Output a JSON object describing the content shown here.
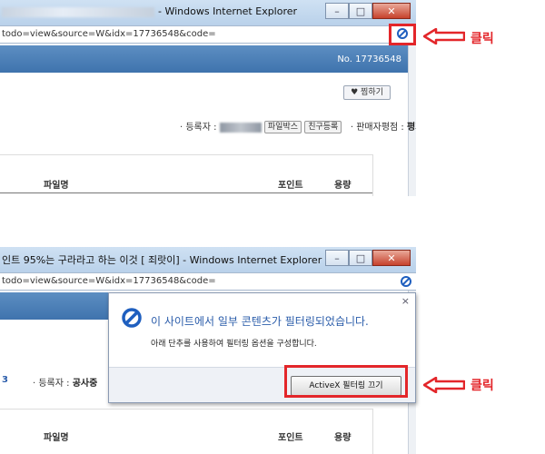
{
  "top_window": {
    "title_suffix": "- Windows Internet Explorer",
    "url": "todo=view&source=W&idx=17736548&code=",
    "record_no": "No. 17736548",
    "save_button": "찜하기",
    "info": {
      "registrant_label": "· 등록자 :",
      "file_box_button": "파일박스",
      "add_friend_button": "친구등록",
      "rating_label": "· 판매자평점 :",
      "rating_value": "평가없음"
    },
    "table_headers": {
      "file_name": "파일명",
      "points": "포인트",
      "capacity": "용량"
    }
  },
  "bottom_window": {
    "title": "인트 95%는 구라라고 하는 이것 [ 죄랏이] - Windows Internet Explorer",
    "url": "todo=view&source=W&idx=17736548&code=",
    "left_fragment": "3",
    "registrant_label": "· 등록자 :",
    "registrant_name": "공사중",
    "table_headers": {
      "file_name": "파일명",
      "points": "포인트",
      "capacity": "용량"
    }
  },
  "infobar": {
    "title": "이 사이트에서 일부 콘텐츠가 필터링되었습니다.",
    "description": "아래 단추를 사용하여 필터링 옵션을 구성합니다.",
    "button": "ActiveX 필터링 끄기",
    "close": "×"
  },
  "annotations": {
    "click_top": "클릭",
    "click_bottom": "클릭",
    "accent_color": "#e3262a"
  },
  "icons": {
    "block": "block-icon",
    "arrow": "arrow-left-icon"
  }
}
